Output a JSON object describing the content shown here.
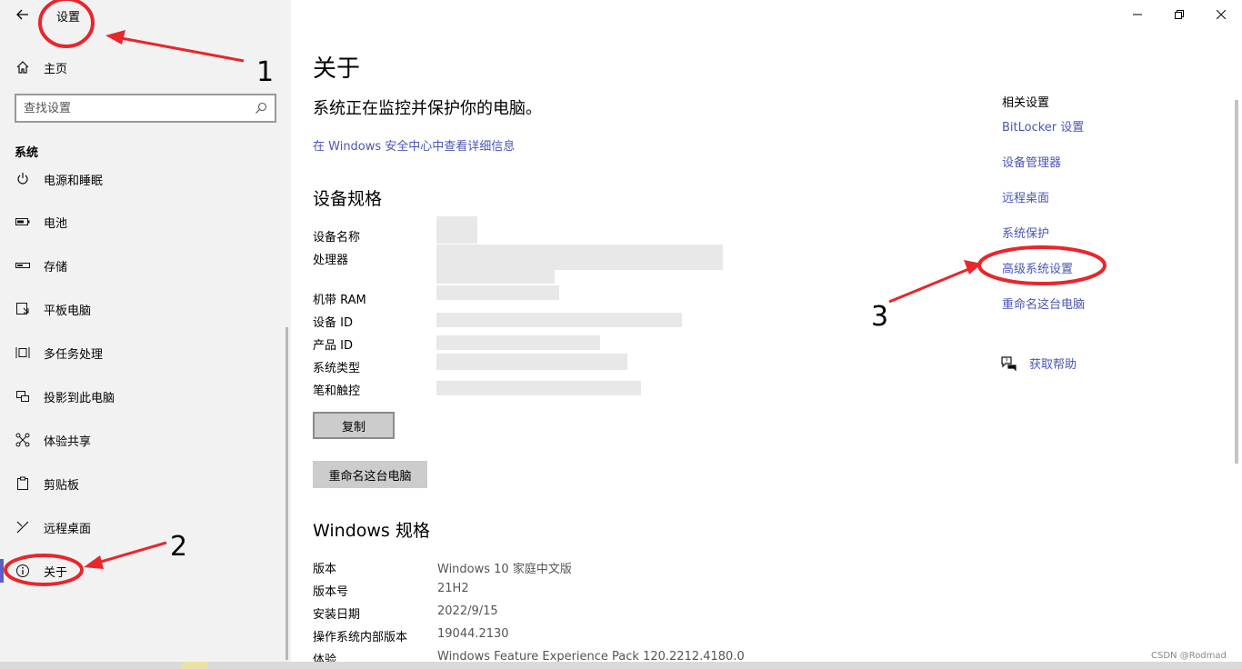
{
  "app": {
    "title": "设置"
  },
  "window": {
    "minimize_icon": "minimize-icon",
    "restore_icon": "restore-icon",
    "close_icon": "close-icon"
  },
  "sidebar": {
    "home_label": "主页",
    "search": {
      "placeholder": "查找设置"
    },
    "section_title": "系统",
    "items": [
      {
        "label": "电源和睡眠",
        "icon": "power-icon"
      },
      {
        "label": "电池",
        "icon": "battery-icon"
      },
      {
        "label": "存储",
        "icon": "storage-icon"
      },
      {
        "label": "平板电脑",
        "icon": "tablet-icon"
      },
      {
        "label": "多任务处理",
        "icon": "multitask-icon"
      },
      {
        "label": "投影到此电脑",
        "icon": "project-icon"
      },
      {
        "label": "体验共享",
        "icon": "share-icon"
      },
      {
        "label": "剪贴板",
        "icon": "clipboard-icon"
      },
      {
        "label": "远程桌面",
        "icon": "remote-desktop-icon"
      },
      {
        "label": "关于",
        "icon": "info-icon",
        "active": true
      }
    ]
  },
  "main": {
    "title": "关于",
    "protect_text": "系统正在监控并保护你的电脑。",
    "security_link": "在 Windows 安全中心中查看详细信息",
    "device_spec_title": "设备规格",
    "device_specs": [
      "设备名称",
      "处理器",
      "机带 RAM",
      "设备 ID",
      "产品 ID",
      "系统类型",
      "笔和触控"
    ],
    "copy_button": "复制",
    "rename_button": "重命名这台电脑",
    "windows_spec_title": "Windows 规格",
    "windows_specs": [
      {
        "label": "版本",
        "value": "Windows 10 家庭中文版"
      },
      {
        "label": "版本号",
        "value": "21H2"
      },
      {
        "label": "安装日期",
        "value": "2022/9/15"
      },
      {
        "label": "操作系统内部版本",
        "value": "19044.2130"
      },
      {
        "label": "体验",
        "value": "Windows Feature Experience Pack 120.2212.4180.0"
      }
    ]
  },
  "related": {
    "title": "相关设置",
    "links": [
      "BitLocker 设置",
      "设备管理器",
      "远程桌面",
      "系统保护",
      "高级系统设置",
      "重命名这台电脑"
    ],
    "help_label": "获取帮助"
  },
  "annotations": [
    "1",
    "2",
    "3"
  ],
  "watermark": "CSDN @Rodmad",
  "colors": {
    "link": "#4a56b8",
    "accent": "#5b5fc7",
    "annotation": "#e8262c"
  }
}
